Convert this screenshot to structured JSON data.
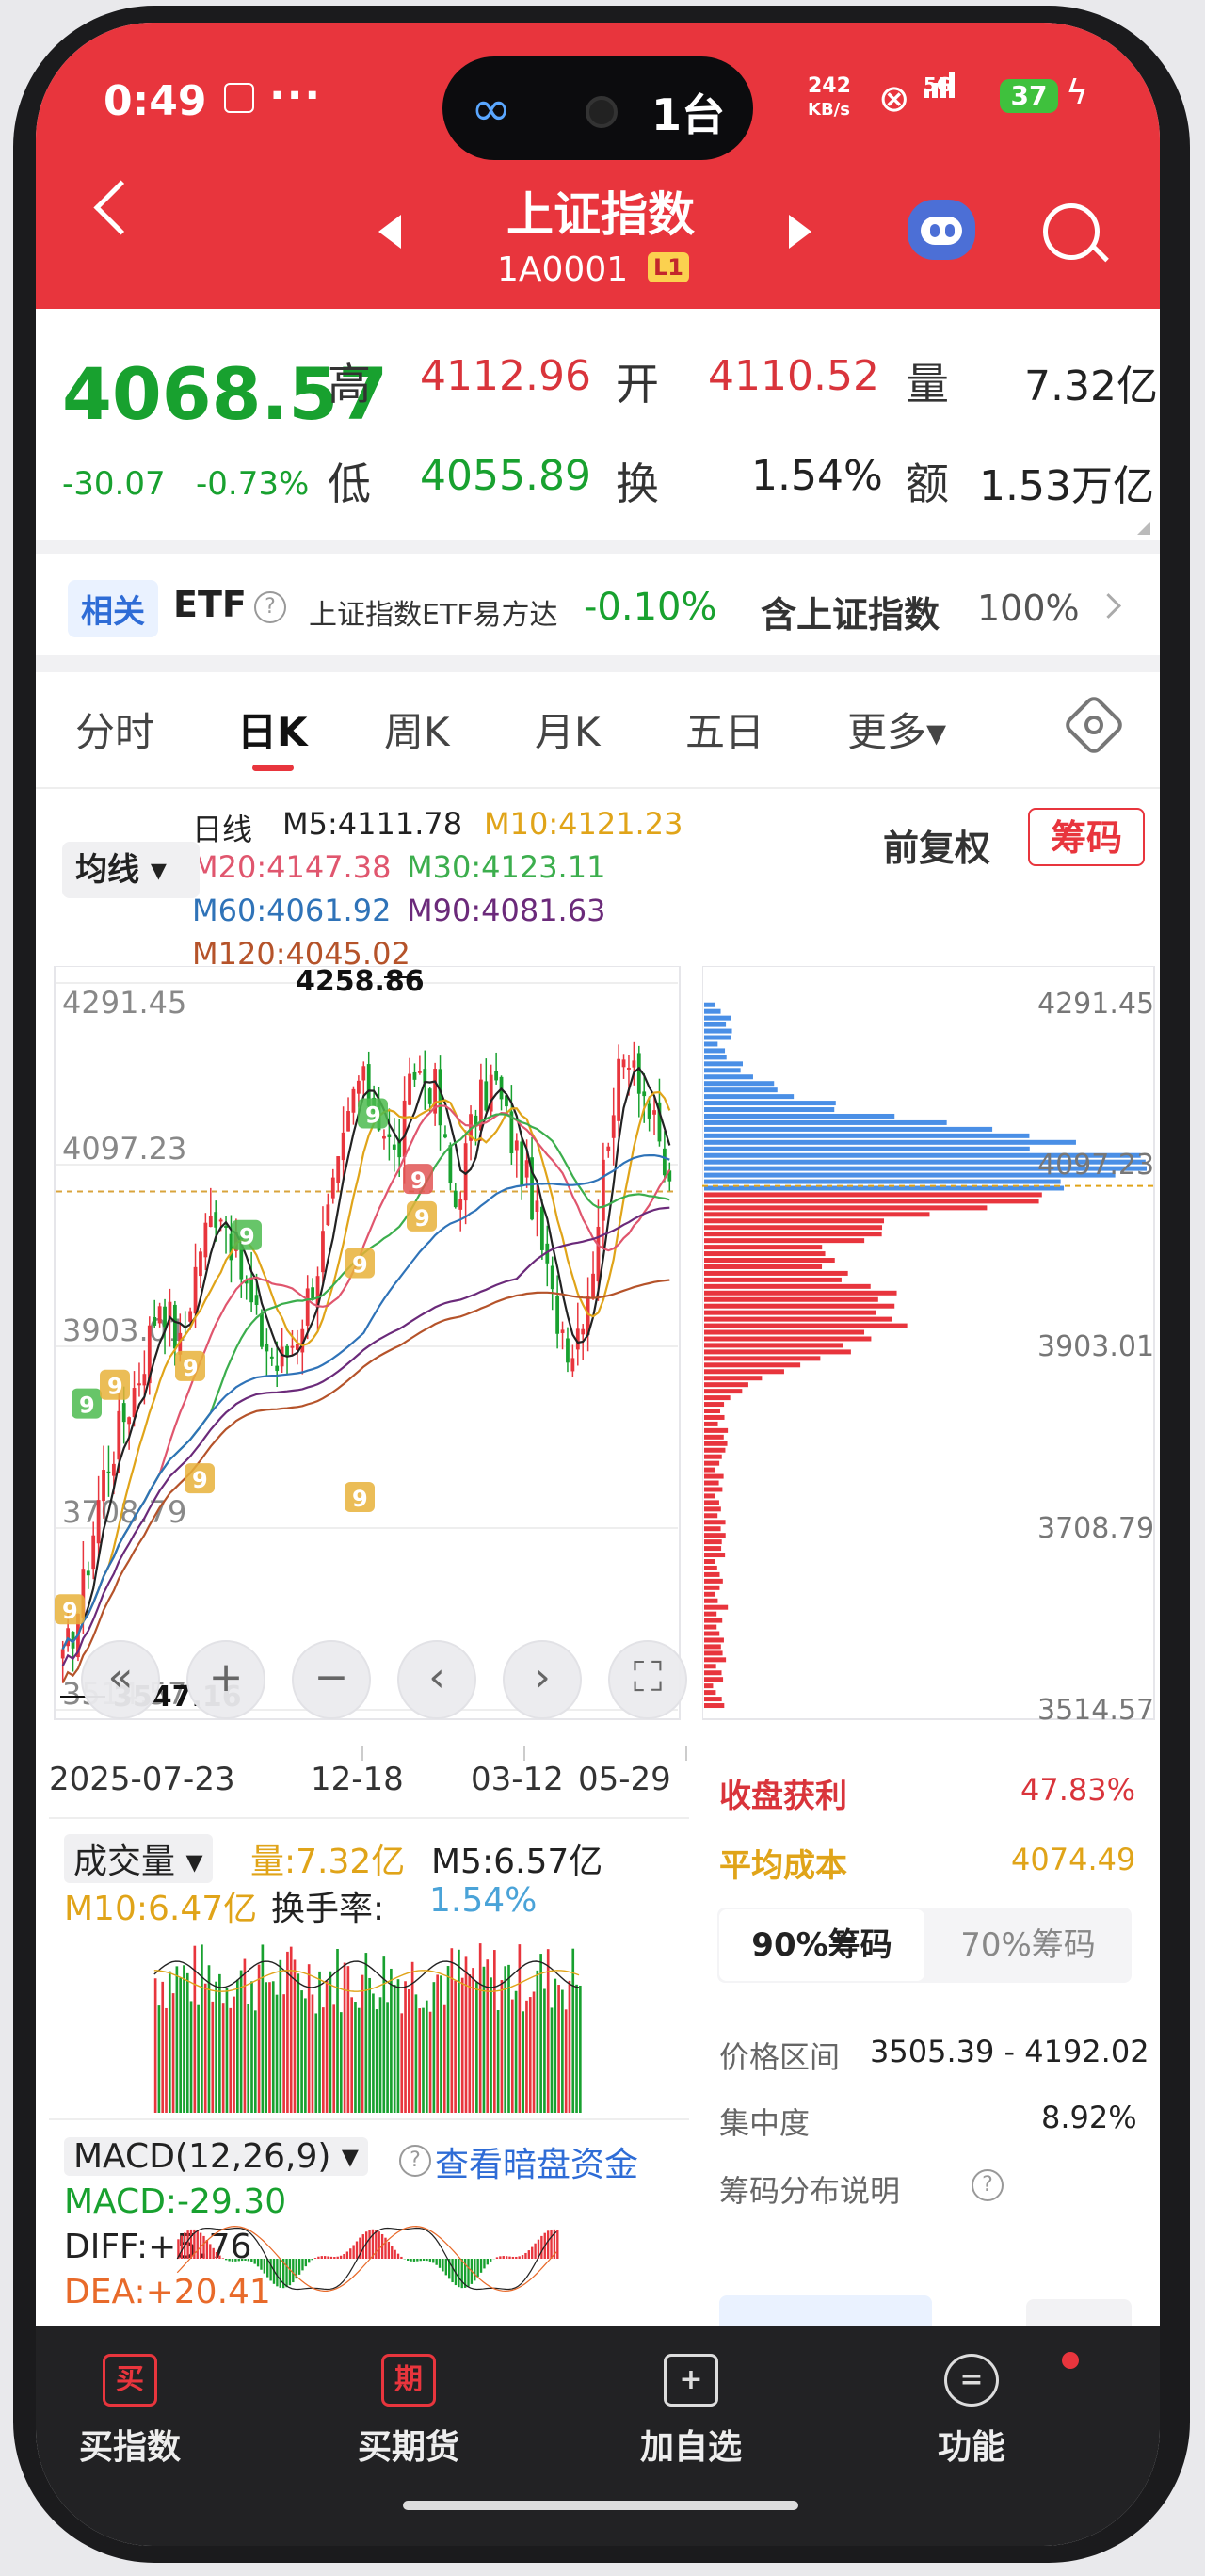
{
  "status": {
    "time": "0:49",
    "dots": "···",
    "island_count": "1台",
    "speed": "242",
    "speed_unit": "KB/s",
    "network": "5G",
    "battery": "37"
  },
  "header": {
    "title": "上证指数",
    "code": "1A0001",
    "level": "L1"
  },
  "quote": {
    "price": "4068.57",
    "change": "-30.07",
    "change_pct": "-0.73%",
    "high_label": "高",
    "high": "4112.96",
    "open_label": "开",
    "open": "4110.52",
    "volume_label": "量",
    "volume": "7.32亿",
    "low_label": "低",
    "low": "4055.89",
    "turnover_label": "换",
    "turnover": "1.54%",
    "amount_label": "额",
    "amount": "1.53万亿"
  },
  "etf": {
    "badge": "相关",
    "label": "ETF",
    "name": "上证指数ETF易方达",
    "change": "-0.10%",
    "holding_label": "含上证指数",
    "holding_pct": "100%"
  },
  "tabs": [
    {
      "label": "分时"
    },
    {
      "label": "日K"
    },
    {
      "label": "周K"
    },
    {
      "label": "月K"
    },
    {
      "label": "五日"
    },
    {
      "label": "更多▾"
    }
  ],
  "ma_legend": {
    "daily": "日线",
    "m5": "M5:4111.78",
    "m10": "M10:4121.23",
    "m20": "M20:4147.38",
    "m30": "M30:4123.11",
    "m60": "M60:4061.92",
    "m90": "M90:4081.63",
    "m120": "M120:4045.02",
    "button": "均线 ▾",
    "adjust": "前复权",
    "chip_button": "筹码"
  },
  "colors": {
    "m5": "#222222",
    "m10": "#e0a419",
    "m20": "#e0566e",
    "m30": "#3cae4d",
    "m60": "#2f73b8",
    "m90": "#6b2a7a",
    "m120": "#b5532a",
    "up": "#e8353d",
    "down": "#18a12f",
    "chip_profit": "#e8353d",
    "chip_loss": "#4a8fe6"
  },
  "kchart_labels": {
    "max_label": "4258.86",
    "min_label": "3547.16",
    "dates": [
      "2025-07-23",
      "12-18",
      "03-12",
      "05-29"
    ]
  },
  "chart_data": {
    "type": "candlestick",
    "title": "",
    "y_ticks": [
      "4291.45",
      "4097.23",
      "3903.01",
      "3708.79",
      "3514.57"
    ],
    "ylim": [
      3514.57,
      4291.45
    ],
    "max": 4258.86,
    "min": 3547.16,
    "ma_lines": [
      "M5",
      "M10",
      "M20",
      "M30",
      "M60",
      "M90",
      "M120"
    ],
    "trend": [
      3560,
      3640,
      3760,
      3820,
      3880,
      3960,
      3900,
      4010,
      4060,
      3990,
      3920,
      3880,
      3920,
      3990,
      4080,
      4190,
      4160,
      4100,
      4200,
      4180,
      4050,
      4150,
      4190,
      4120,
      4060,
      3950,
      3900,
      3980,
      4160,
      4230,
      4150,
      4070
    ]
  },
  "chip": {
    "y_ticks": [
      "4291.45",
      "4097.23",
      "3903.01",
      "3708.79",
      "3514.57"
    ],
    "profit_label": "收盘获利",
    "profit": "47.83%",
    "cost_label": "平均成本",
    "cost": "4074.49",
    "tab_90": "90%筹码",
    "tab_70": "70%筹码",
    "range_label": "价格区间",
    "range": "3505.39 - 4192.02",
    "concentration_label": "集中度",
    "concentration": "8.92%",
    "explain": "筹码分布说明"
  },
  "volume": {
    "label": "成交量 ▾",
    "vol": "量:7.32亿",
    "m5": "M5:6.57亿",
    "m10": "M10:6.47亿",
    "turnover_label": "换手率:",
    "turnover": "1.54%"
  },
  "macd": {
    "label": "MACD(12,26,9) ▾",
    "dark_link": "查看暗盘资金",
    "macd": "MACD:-29.30",
    "diff": "DIFF:+5.76",
    "dea": "DEA:+20.41"
  },
  "bottom_bar": [
    {
      "icon": "买",
      "label": "买指数"
    },
    {
      "icon": "期",
      "label": "买期货"
    },
    {
      "icon": "+",
      "label": "加自选"
    },
    {
      "icon": "=",
      "label": "功能"
    }
  ]
}
